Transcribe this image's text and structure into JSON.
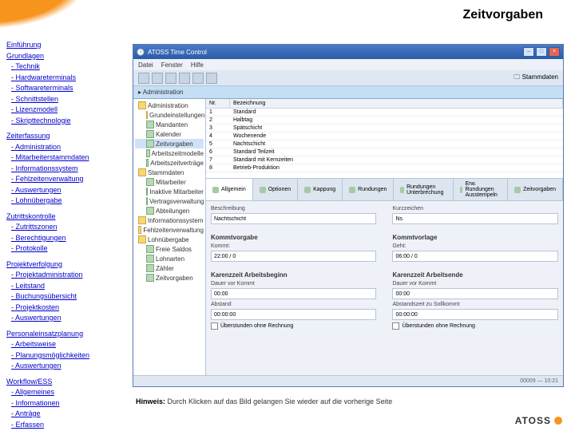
{
  "page": {
    "title": "Zeitvorgaben",
    "hint_label": "Hinweis:",
    "hint_text": "Durch Klicken auf das Bild gelangen Sie wieder auf die vorherige Seite",
    "logo": "ATOSS"
  },
  "nav": {
    "intro": "Einführung",
    "sections": [
      {
        "head": "Grundlagen",
        "items": [
          "Technik",
          "Hardwareterminals",
          "Softwareterminals",
          "Schnittstellen",
          "Lizenzmodell",
          "Skripttechnologie"
        ]
      },
      {
        "head": "Zeiterfassung",
        "items": [
          "Administration",
          "Mitarbeiterstammdaten",
          "Informationssystem",
          "Fehlzeitenverwaltung",
          "Auswertungen",
          "Lohnübergabe"
        ]
      },
      {
        "head": "Zutrittskontrolle",
        "items": [
          "Zutrittszonen",
          "Berechtigungen",
          "Protokolle"
        ]
      },
      {
        "head": "Projektverfolgung",
        "items": [
          "Projektadministration",
          "Leitstand",
          "Buchungsübersicht",
          "Projektkosten",
          "Auswertungen"
        ]
      },
      {
        "head": "Personaleinsatzplanung",
        "items": [
          "Arbeitsweise",
          "Planungsmöglichkeiten",
          "Auswertungen"
        ]
      },
      {
        "head": "Workflow/ESS",
        "items": [
          "Allgemeines",
          "Informationen",
          "Anträge",
          "Erfassen"
        ]
      }
    ]
  },
  "app": {
    "title": "ATOSS Time Control",
    "menu": [
      "Datei",
      "Fenster",
      "Hilfe"
    ],
    "subbar": "Administration",
    "stammdaten": "Stammdaten",
    "tree": [
      {
        "t": "Administration",
        "l": 0,
        "i": "f"
      },
      {
        "t": "Grundeinstellungen",
        "l": 1,
        "i": "f"
      },
      {
        "t": "Mandanten",
        "l": 1,
        "i": "l"
      },
      {
        "t": "Kalender",
        "l": 1,
        "i": "l"
      },
      {
        "t": "Zeitvorgaben",
        "l": 1,
        "i": "l",
        "sel": true
      },
      {
        "t": "Arbeitszeitmodelle",
        "l": 1,
        "i": "l"
      },
      {
        "t": "Arbeitszeitverträge",
        "l": 1,
        "i": "l"
      },
      {
        "t": "Stammdaten",
        "l": 0,
        "i": "f"
      },
      {
        "t": "Mitarbeiter",
        "l": 1,
        "i": "l"
      },
      {
        "t": "Inaktive Mitarbeiter",
        "l": 1,
        "i": "l"
      },
      {
        "t": "Vertragsverwaltung",
        "l": 1,
        "i": "l"
      },
      {
        "t": "Abteilungen",
        "l": 1,
        "i": "l"
      },
      {
        "t": "Informationssystem",
        "l": 0,
        "i": "f"
      },
      {
        "t": "Fehlzeitenverwaltung",
        "l": 0,
        "i": "f"
      },
      {
        "t": "Lohnübergabe",
        "l": 0,
        "i": "f"
      },
      {
        "t": "Freie Saldos",
        "l": 1,
        "i": "l"
      },
      {
        "t": "Lohnarten",
        "l": 1,
        "i": "l"
      },
      {
        "t": "Zähler",
        "l": 1,
        "i": "l"
      },
      {
        "t": "Zeitvorgaben",
        "l": 1,
        "i": "l"
      }
    ],
    "list": {
      "cols": [
        "Nr.",
        "Bezeichnung"
      ],
      "rows": [
        [
          "1",
          "Standard"
        ],
        [
          "2",
          "Halbtag"
        ],
        [
          "3",
          "Spätschicht"
        ],
        [
          "4",
          "Wochenende"
        ],
        [
          "5",
          "Nachtschicht"
        ],
        [
          "6",
          "Standard Teilzeit"
        ],
        [
          "7",
          "Standard mit Kernzeiten"
        ],
        [
          "8",
          "Betrieb-Produktion"
        ]
      ]
    },
    "tabs": [
      "Allgemein",
      "Optionen",
      "Kappung",
      "Rundungen",
      "Rundungen Unterbrechung",
      "Erw. Rundungen Ausstempeln",
      "Zeitvorgaben"
    ],
    "detail": {
      "desc_label": "Beschreibung",
      "desc_val": "Nachtschicht",
      "kurz_label": "Kurzzeichen",
      "kurz_val": "Ns",
      "sec_a": "Kommtvorgabe",
      "sec_b": "Kommtvorlage",
      "kb_label": "Kommt:",
      "kb_val": "22:00 / 0",
      "ke_label": "Geht:",
      "ke_val": "06:00 / 0",
      "sec_c": "Karenzzeit Arbeitsbeginn",
      "sec_d": "Karenzzeit Arbeitsende",
      "dnk_label": "Dauer vor Kommt",
      "dnk_val": "00:00",
      "dnk_label2": "Dauer vor Kommt",
      "abst_label": "Abstand",
      "abst_val": "00:00:00",
      "abst_label2": "Abstandszeit zu Sollkommt",
      "chk1": "Überstunden ohne Rechnung",
      "chk2": "Überstunden ohne Rechnung"
    },
    "status": "00009 — 10:21"
  }
}
